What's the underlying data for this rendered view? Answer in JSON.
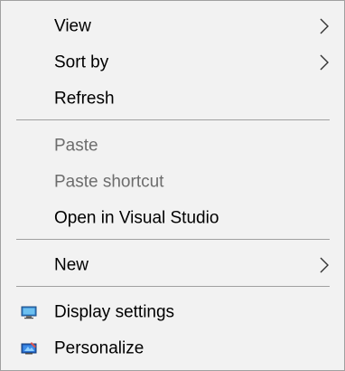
{
  "context_menu": {
    "items": [
      {
        "label": "View",
        "has_submenu": true,
        "enabled": true
      },
      {
        "label": "Sort by",
        "has_submenu": true,
        "enabled": true
      },
      {
        "label": "Refresh",
        "has_submenu": false,
        "enabled": true
      },
      {
        "label": "Paste",
        "has_submenu": false,
        "enabled": false
      },
      {
        "label": "Paste shortcut",
        "has_submenu": false,
        "enabled": false
      },
      {
        "label": "Open in Visual Studio",
        "has_submenu": false,
        "enabled": true
      },
      {
        "label": "New",
        "has_submenu": true,
        "enabled": true
      },
      {
        "label": "Display settings",
        "icon": "display-settings-icon",
        "enabled": true
      },
      {
        "label": "Personalize",
        "icon": "personalize-icon",
        "enabled": true
      }
    ],
    "colors": {
      "background": "#f2f2f2",
      "border": "#a0a0a0",
      "text": "#000000",
      "disabled_text": "#6d6d6d",
      "separator": "#a0a0a0"
    }
  }
}
